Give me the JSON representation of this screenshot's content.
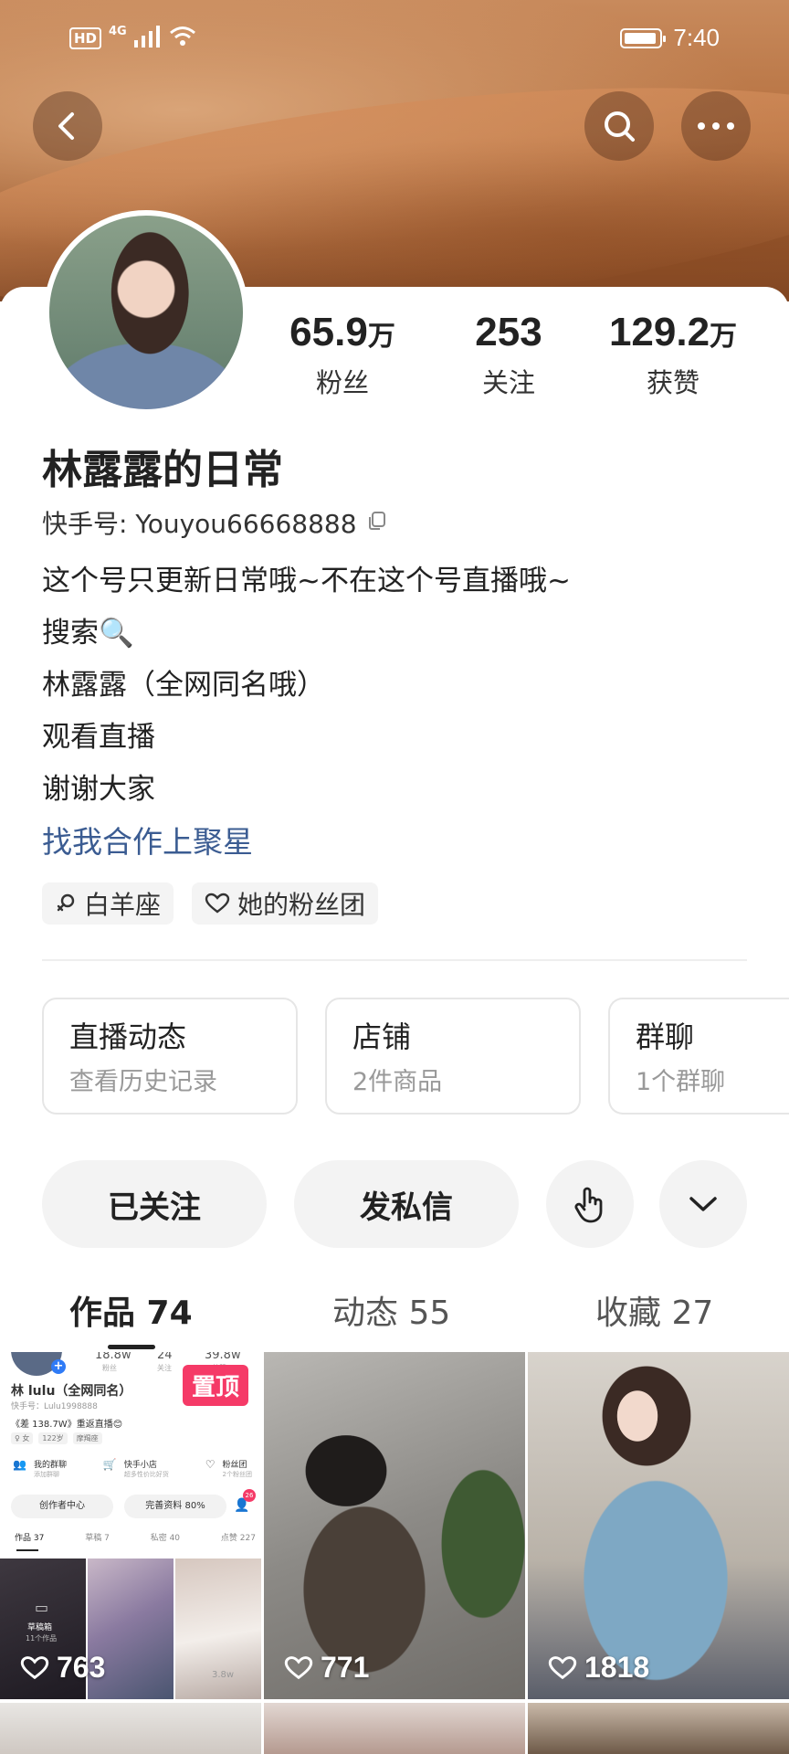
{
  "status_bar": {
    "hd": "HD",
    "network": "4G",
    "time": "7:40"
  },
  "header": {
    "back_icon": "back-arrow-icon",
    "search_icon": "search-icon",
    "more_icon": "more-dots-icon"
  },
  "profile": {
    "stats": [
      {
        "value": "65.9",
        "unit": "万",
        "label": "粉丝"
      },
      {
        "value": "253",
        "unit": "",
        "label": "关注"
      },
      {
        "value": "129.2",
        "unit": "万",
        "label": "获赞"
      }
    ],
    "name": "林露露的日常",
    "kuaishou_id_label": "快手号: Youyou66668888",
    "bio_lines": [
      "这个号只更新日常哦~不在这个号直播哦~",
      "搜索🔍",
      "林露露（全网同名哦）",
      "观看直播",
      "谢谢大家"
    ],
    "bio_link": "找我合作上聚星",
    "tags": [
      {
        "icon": "female-icon",
        "label": "白羊座"
      },
      {
        "icon": "heart-icon",
        "label": "她的粉丝团"
      }
    ]
  },
  "features": [
    {
      "title": "直播动态",
      "subtitle": "查看历史记录"
    },
    {
      "title": "店铺",
      "subtitle": "2件商品"
    },
    {
      "title": "群聊",
      "subtitle": "1个群聊"
    }
  ],
  "actions": {
    "follow": "已关注",
    "message": "发私信",
    "tap_icon": "tap-hand-icon",
    "expand_icon": "chevron-down-icon"
  },
  "tabs": [
    {
      "label": "作品 74",
      "active": true
    },
    {
      "label": "动态 55",
      "active": false
    },
    {
      "label": "收藏 27",
      "active": false
    }
  ],
  "grid": [
    {
      "likes": "763",
      "pinned_label": "置顶"
    },
    {
      "likes": "771"
    },
    {
      "likes": "1818"
    }
  ],
  "thumb1": {
    "stats": [
      "18.8w",
      "24",
      "39.8w"
    ],
    "stat_labels": [
      "粉丝",
      "关注",
      "获赞"
    ],
    "name": "林 lulu（全网同名）",
    "id": "快手号：Lulu1998888",
    "line": "《差 138.7W》重返直播😊",
    "chips": [
      "♀ 女",
      "122岁",
      "摩羯座"
    ],
    "features": [
      {
        "title": "我的群聊",
        "sub": "添加群聊"
      },
      {
        "title": "快手小店",
        "sub": "超多性价比好货"
      },
      {
        "title": "粉丝团",
        "sub": "2个粉丝团"
      }
    ],
    "buttons": [
      "创作者中心",
      "完善资料 80%"
    ],
    "badge": "26",
    "tabs": [
      "作品 37",
      "草稿 7",
      "私密 40",
      "点赞 227"
    ],
    "draft_title": "草稿箱",
    "draft_sub": "11个作品",
    "views": "3.8w"
  }
}
